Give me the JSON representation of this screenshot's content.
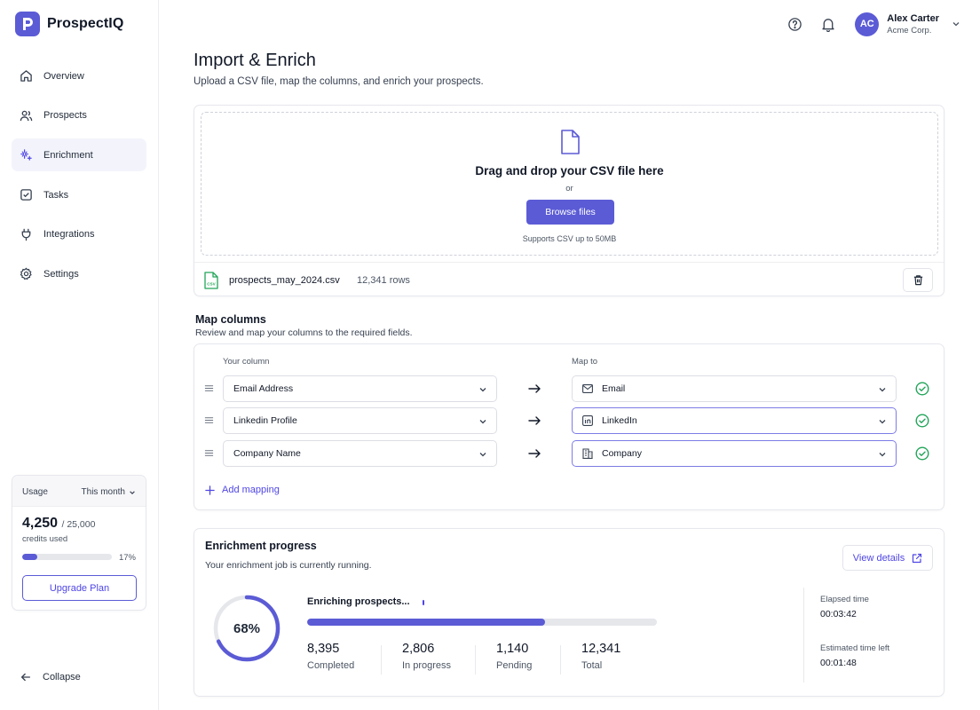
{
  "app": {
    "name": "ProspectIQ",
    "brand_color": "#5b5bd6"
  },
  "sidebar": {
    "items": [
      {
        "label": "Overview",
        "icon": "home-icon",
        "active": false
      },
      {
        "label": "Prospects",
        "icon": "users-icon",
        "active": false
      },
      {
        "label": "Enrichment",
        "icon": "sparkles-icon",
        "active": true
      },
      {
        "label": "Tasks",
        "icon": "checkbox-icon",
        "active": false
      },
      {
        "label": "Integrations",
        "icon": "plug-icon",
        "active": false
      },
      {
        "label": "Settings",
        "icon": "gear-icon",
        "active": false
      }
    ],
    "usage": {
      "label": "Usage",
      "period": "This month",
      "used": "4,250",
      "total": "/ 25,000",
      "sub": "credits used",
      "percent_label": "17%",
      "percent": 17,
      "upgrade_label": "Upgrade Plan"
    },
    "collapse_label": "Collapse"
  },
  "header": {
    "user": {
      "initials": "AC",
      "name": "Alex Carter",
      "org": "Acme Corp."
    }
  },
  "page": {
    "title": "Import & Enrich",
    "subtitle": "Upload a CSV file, map the columns, and enrich your prospects."
  },
  "upload": {
    "title": "Drag and drop your CSV file here",
    "or": "or",
    "button": "Browse files",
    "note": "Supports CSV up to 50MB",
    "file": {
      "name": "prospects_may_2024.csv",
      "rows": "12,341 rows"
    }
  },
  "mapping": {
    "title": "Map columns",
    "subtitle": "Review and map your columns to the required fields.",
    "col_header": "Your column",
    "map_header": "Map to",
    "rows": [
      {
        "source": "Email Address",
        "target": "Email",
        "icon": "mail-icon"
      },
      {
        "source": "Linkedin Profile",
        "target": "LinkedIn",
        "icon": "linkedin-icon"
      },
      {
        "source": "Company Name",
        "target": "Company",
        "icon": "building-icon"
      }
    ],
    "add_label": "Add mapping"
  },
  "progress": {
    "title": "Enrichment progress",
    "subtitle": "Your enrichment job is currently running.",
    "view_label": "View details",
    "percent_label": "68%",
    "percent": 68,
    "status": "Enriching prospects...",
    "bar_percent": 68,
    "stats": [
      {
        "value": "8,395",
        "label": "Completed"
      },
      {
        "value": "2,806",
        "label": "In progress"
      },
      {
        "value": "1,140",
        "label": "Pending"
      },
      {
        "value": "12,341",
        "label": "Total"
      }
    ],
    "elapsed_label": "Elapsed time",
    "elapsed": "00:03:42",
    "remaining_label": "Estimated time left",
    "remaining": "00:01:48"
  }
}
